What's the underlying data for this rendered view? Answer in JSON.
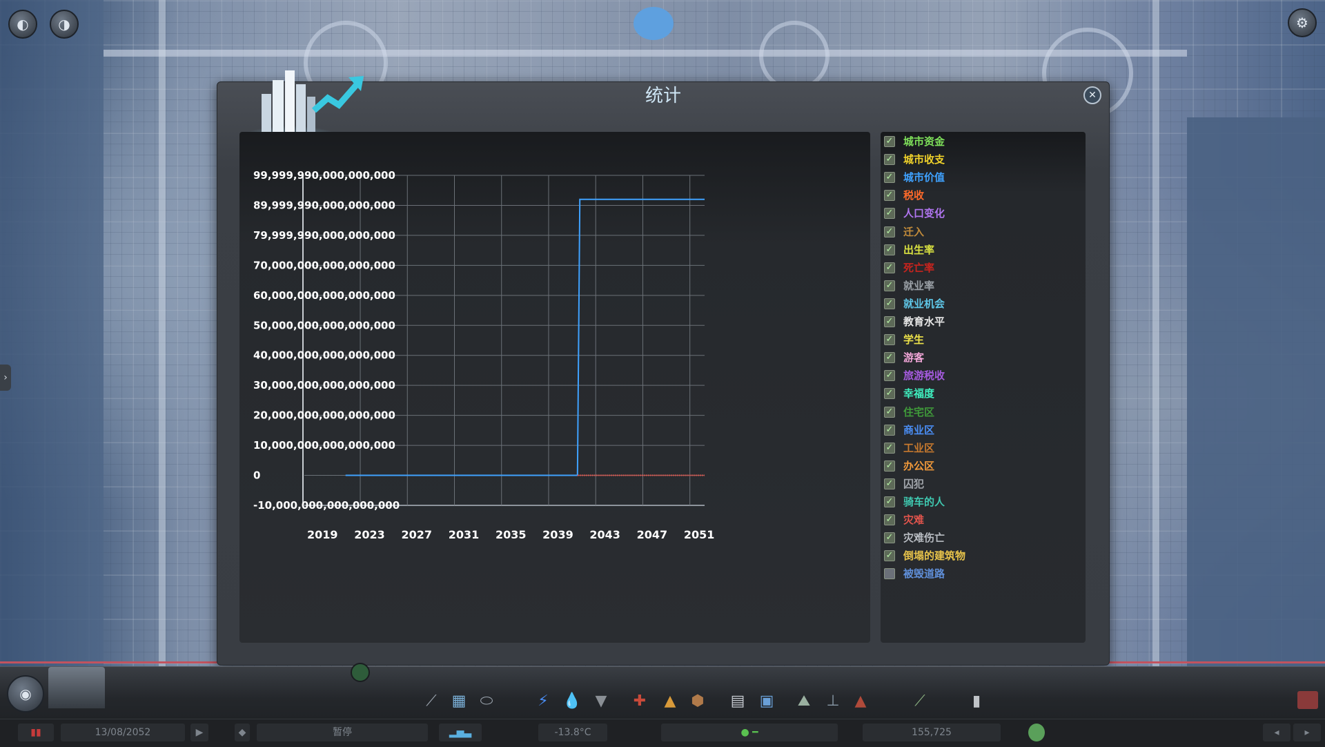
{
  "dialog": {
    "title": "统计",
    "close_glyph": "✕"
  },
  "chart_data": {
    "type": "line",
    "x_ticks": [
      "2019",
      "2023",
      "2027",
      "2031",
      "2035",
      "2039",
      "2043",
      "2047",
      "2051"
    ],
    "y_ticks": [
      "99,999,990,000,000,000",
      "89,999,990,000,000,000",
      "79,999,990,000,000,000",
      "70,000,000,000,000,000",
      "60,000,000,000,000,000",
      "50,000,000,000,000,000",
      "40,000,000,000,000,000",
      "30,000,000,000,000,000",
      "20,000,000,000,000,000",
      "10,000,000,000,000,000",
      "0",
      "-10,000,000,000,000,000"
    ],
    "ylim": [
      -10000000000000000,
      99999990000000000
    ],
    "xlim": [
      2019,
      2053
    ],
    "grid": true,
    "series": [
      {
        "name": "城市价值",
        "color": "#3fa2ff",
        "points": [
          [
            2022.5,
            0
          ],
          [
            2042.2,
            0
          ],
          [
            2042.4,
            92000000000000000
          ],
          [
            2053,
            92000000000000000
          ]
        ]
      },
      {
        "name": "灾难",
        "color": "#e0544c",
        "points": [
          [
            2042.2,
            0
          ],
          [
            2053,
            0
          ]
        ]
      }
    ]
  },
  "legend": [
    {
      "label": "城市资金",
      "color": "#7ee05a",
      "checked": true
    },
    {
      "label": "城市收支",
      "color": "#f0d22a",
      "checked": true
    },
    {
      "label": "城市价值",
      "color": "#3fa2ff",
      "checked": true
    },
    {
      "label": "税收",
      "color": "#ff6a2a",
      "checked": true
    },
    {
      "label": "人口变化",
      "color": "#b075f0",
      "checked": true
    },
    {
      "label": "迁入",
      "color": "#c08a3a",
      "checked": true
    },
    {
      "label": "出生率",
      "color": "#d8e040",
      "checked": true
    },
    {
      "label": "死亡率",
      "color": "#c8241e",
      "checked": true
    },
    {
      "label": "就业率",
      "color": "#9aa0a6",
      "checked": true
    },
    {
      "label": "就业机会",
      "color": "#5fc7e8",
      "checked": true
    },
    {
      "label": "教育水平",
      "color": "#e6e6e6",
      "checked": true
    },
    {
      "label": "学生",
      "color": "#ede24a",
      "checked": true
    },
    {
      "label": "游客",
      "color": "#f2a6d8",
      "checked": true
    },
    {
      "label": "旅游税收",
      "color": "#a65be0",
      "checked": true
    },
    {
      "label": "幸福度",
      "color": "#3ff0c0",
      "checked": true
    },
    {
      "label": "住宅区",
      "color": "#3f9a3a",
      "checked": true
    },
    {
      "label": "商业区",
      "color": "#4a8ef5",
      "checked": true
    },
    {
      "label": "工业区",
      "color": "#c87a2e",
      "checked": true
    },
    {
      "label": "办公区",
      "color": "#f29a3a",
      "checked": true
    },
    {
      "label": "囚犯",
      "color": "#a0a4aa",
      "checked": true
    },
    {
      "label": "骑车的人",
      "color": "#3fc8b0",
      "checked": true
    },
    {
      "label": "灾难",
      "color": "#e0544c",
      "checked": true
    },
    {
      "label": "灾难伤亡",
      "color": "#b8bcc2",
      "checked": true
    },
    {
      "label": "倒塌的建筑物",
      "color": "#e6c24a",
      "checked": true
    },
    {
      "label": "被毁道路",
      "color": "#5f8ed8",
      "checked": false
    }
  ],
  "status_bar": {
    "date": "13/08/2052",
    "temperature": "-13.8°C",
    "population": "155,725",
    "speed_label": "暂停"
  },
  "toolbar_icons": [
    "road-icon",
    "zoning-icon",
    "district-icon",
    "electricity-icon",
    "water-icon",
    "garbage-icon",
    "healthcare-icon",
    "fire-icon",
    "police-icon",
    "education-icon",
    "transport-icon",
    "landscaping-icon",
    "unique-building-icon",
    "monument-icon",
    "park-icon",
    "policy-icon"
  ]
}
